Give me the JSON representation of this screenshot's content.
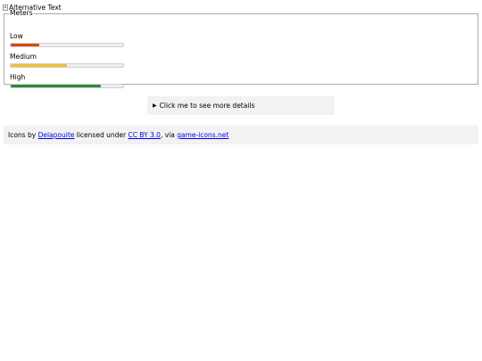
{
  "image": {
    "alt": "Alternative Text",
    "icon": "broken-image-icon"
  },
  "meters": {
    "legend": "Meters",
    "items": [
      {
        "label": "Low",
        "value": 0.25,
        "color": "#d9480f"
      },
      {
        "label": "Medium",
        "value": 0.5,
        "color": "#f2c037"
      },
      {
        "label": "High",
        "value": 0.8,
        "color": "#2b8a3e"
      }
    ]
  },
  "details": {
    "summary": "Click me to see more details",
    "icon": "triangle-right-icon"
  },
  "credits": {
    "prefix": "Icons by",
    "author": "Delapouite",
    "middle": "licensed under",
    "license": "CC BY 3.0",
    "via": ", via",
    "site": "game-icons.net",
    "link_color": "#0000ee"
  }
}
